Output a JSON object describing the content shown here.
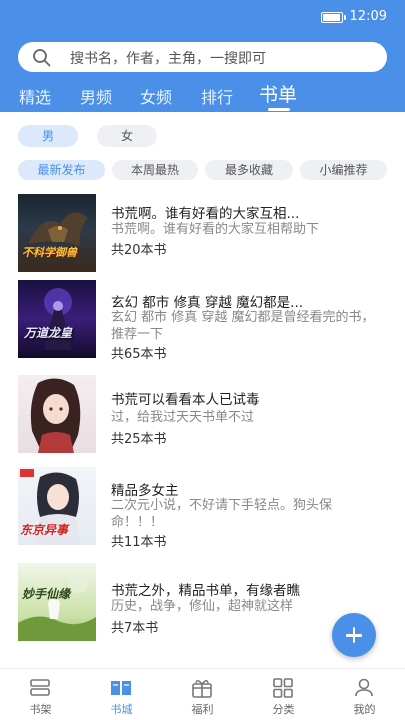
{
  "status": {
    "time": "12:09",
    "battery_level": 0.85
  },
  "search": {
    "placeholder": "搜书名，作者，主角，一搜即可"
  },
  "tabs": [
    "精选",
    "男频",
    "女频",
    "排行",
    "书单"
  ],
  "active_tab": "书单",
  "gender_filters": [
    "男",
    "女"
  ],
  "active_gender": "男",
  "sort_filters": [
    "最新发布",
    "本周最热",
    "最多收藏",
    "小编推荐"
  ],
  "active_sort": "最新发布",
  "booklists": [
    {
      "title": "书荒啊。谁有好看的大家互相...",
      "desc": "书荒啊。谁有好看的大家互相帮助下",
      "count": "共20本书",
      "cover_text": "不科学御兽"
    },
    {
      "title": "玄幻 都市 修真 穿越 魔幻都是...",
      "desc": "玄幻 都市 修真 穿越 魔幻都是曾经看完的书，推荐一下",
      "count": "共65本书",
      "cover_text": "万道龙皇"
    },
    {
      "title": "书荒可以看看本人已试毒",
      "desc": "过，给我过天天书单不过",
      "count": "共25本书",
      "cover_text": ""
    },
    {
      "title": "精品多女主",
      "desc": "二次元小说，不好请下手轻点。狗头保命！！！",
      "count": "共11本书",
      "cover_text": "东京异事"
    },
    {
      "title": "书荒之外，精品书单，有缘者瞧",
      "desc": "历史，战争，修仙，超神就这样",
      "count": "共7本书",
      "cover_text": "妙手仙缘"
    }
  ],
  "bottom_nav": [
    "书架",
    "书城",
    "福利",
    "分类",
    "我的"
  ],
  "active_nav": "书城",
  "colors": {
    "accent": "#4a8fe8",
    "header_bg": "#4a8fe8"
  }
}
